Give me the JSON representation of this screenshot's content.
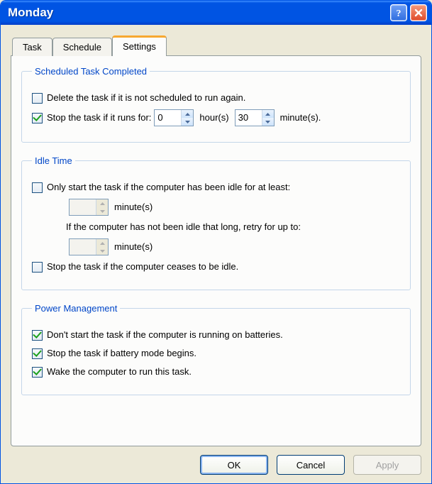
{
  "window": {
    "title": "Monday"
  },
  "tabs": [
    {
      "label": "Task"
    },
    {
      "label": "Schedule"
    },
    {
      "label": "Settings"
    }
  ],
  "active_tab_index": 2,
  "groups": {
    "completed": {
      "legend": "Scheduled Task Completed",
      "delete_if_not_scheduled": {
        "checked": false,
        "label": "Delete the task if it is not scheduled to run again."
      },
      "stop_if_runs_for": {
        "checked": true,
        "label_prefix": "Stop the task if it runs for:",
        "hours": "0",
        "hours_unit": "hour(s)",
        "minutes": "30",
        "minutes_unit": "minute(s)."
      }
    },
    "idle": {
      "legend": "Idle Time",
      "only_start_if_idle": {
        "checked": false,
        "label": "Only start the task if the computer has been idle for at least:"
      },
      "idle_minutes": {
        "value": "",
        "unit": "minute(s)"
      },
      "retry_label": "If the computer has not been idle that long, retry for up to:",
      "retry_minutes": {
        "value": "",
        "unit": "minute(s)"
      },
      "stop_if_ceases_idle": {
        "checked": false,
        "label": "Stop the task if the computer ceases to be idle."
      }
    },
    "power": {
      "legend": "Power Management",
      "dont_start_on_batteries": {
        "checked": true,
        "label": "Don't start the task if the computer is running on batteries."
      },
      "stop_if_battery_begins": {
        "checked": true,
        "label": "Stop the task if battery mode begins."
      },
      "wake_to_run": {
        "checked": true,
        "label": "Wake the computer to run this task."
      }
    }
  },
  "buttons": {
    "ok": "OK",
    "cancel": "Cancel",
    "apply": "Apply"
  }
}
